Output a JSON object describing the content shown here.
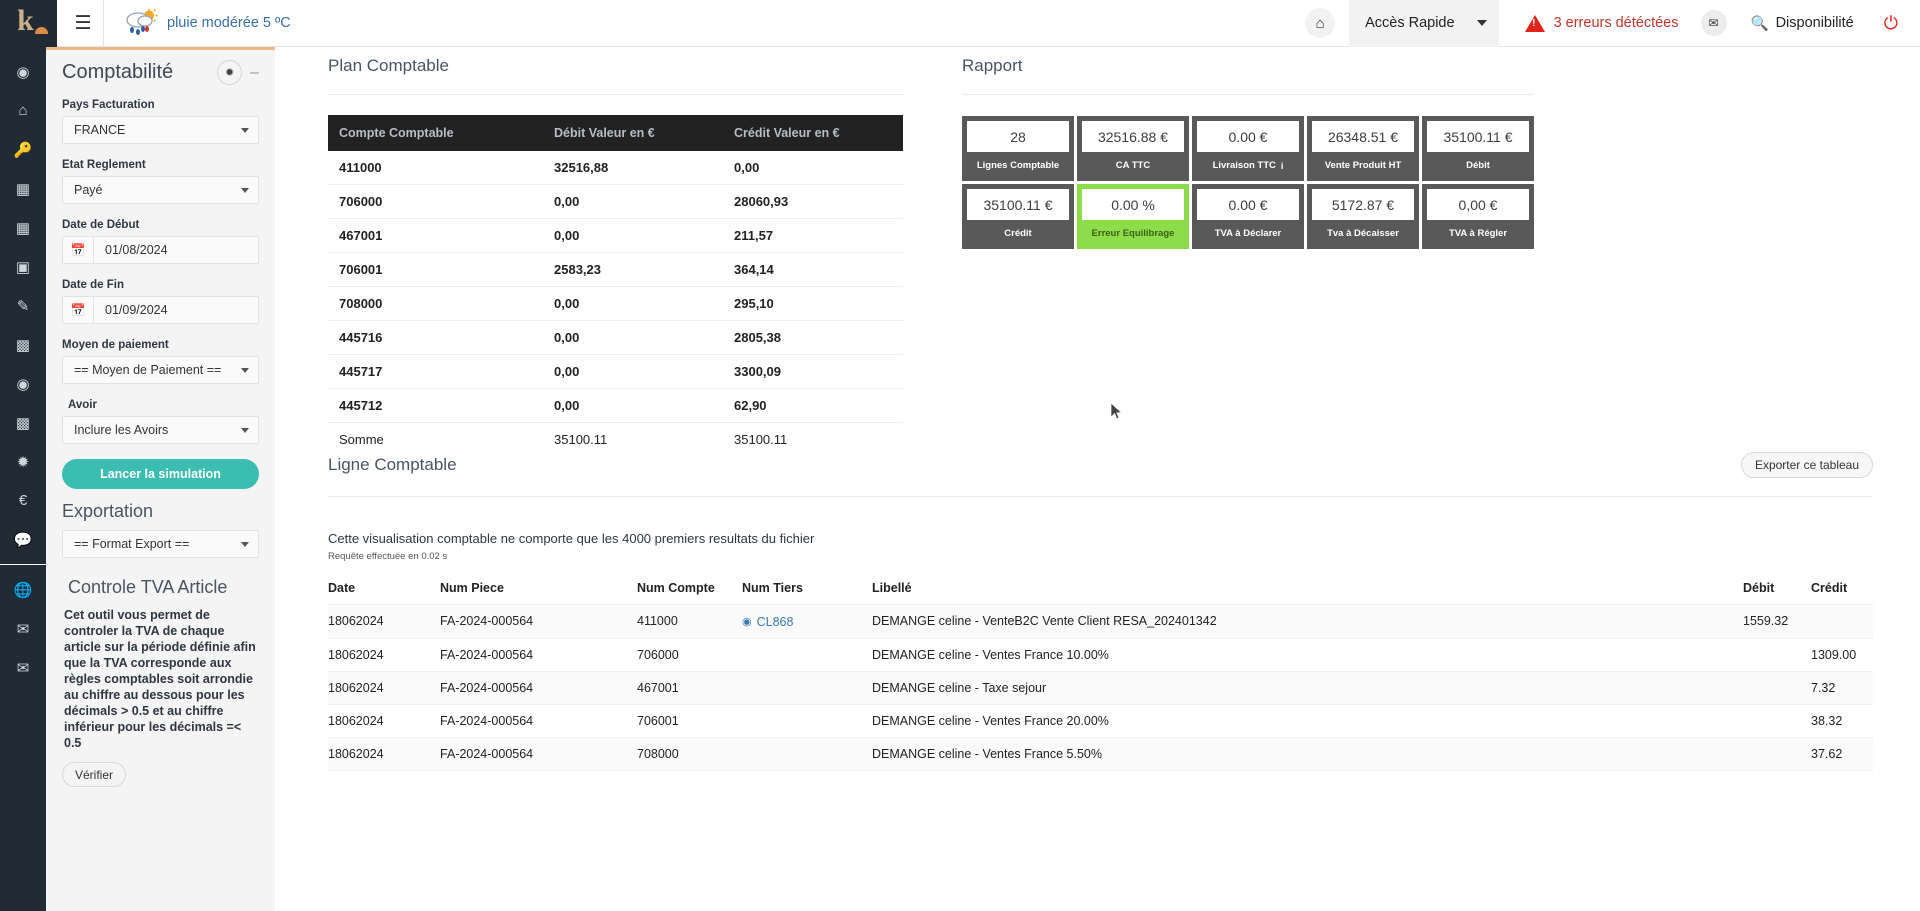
{
  "topbar": {
    "logo_letter": "k",
    "menu_icon": "hamburger-icon",
    "weather": "pluie modérée 5 ºC",
    "home_icon": "home-icon",
    "quick_access": "Accès Rapide",
    "errors": "3 erreurs détéctées",
    "mail_icon": "envelope-icon",
    "availability": "Disponibilité",
    "power_icon": "power-icon"
  },
  "rail": {
    "items": [
      {
        "name": "dashboard-icon",
        "glyph": "◐"
      },
      {
        "name": "home-icon",
        "glyph": "⌂"
      },
      {
        "name": "key-icon",
        "glyph": "🔑"
      },
      {
        "name": "card-icon",
        "glyph": "▤"
      },
      {
        "name": "calculator-icon",
        "glyph": "▦"
      },
      {
        "name": "contact-icon",
        "glyph": "▣"
      },
      {
        "name": "pencil-icon",
        "glyph": "✎"
      },
      {
        "name": "map-icon",
        "glyph": "▥"
      },
      {
        "name": "user-icon",
        "glyph": "◉"
      },
      {
        "name": "gift-icon",
        "glyph": "▩"
      },
      {
        "name": "settings-icon",
        "glyph": "✿"
      },
      {
        "name": "euro-icon",
        "glyph": "€"
      },
      {
        "name": "chat-icon",
        "glyph": "💬"
      },
      {
        "name": "globe-icon",
        "glyph": "⊕"
      },
      {
        "name": "mail-icon",
        "glyph": "✉"
      },
      {
        "name": "mail2-icon",
        "glyph": "✉"
      }
    ]
  },
  "panel": {
    "title": "Comptabilité",
    "gear_icon": "gear-icon",
    "minimize_icon": "minus-icon",
    "fields": {
      "pays_label": "Pays Facturation",
      "pays_value": "FRANCE",
      "etat_label": "Etat Reglement",
      "etat_value": "Payé",
      "debut_label": "Date de Début",
      "debut_value": "01/08/2024",
      "fin_label": "Date de Fin",
      "fin_value": "01/09/2024",
      "moyen_label": "Moyen de paiement",
      "moyen_value": "== Moyen de Paiement ==",
      "avoir_label": "Avoir",
      "avoir_value": "Inclure les Avoirs"
    },
    "simulate_button": "Lancer la simulation",
    "export_title": "Exportation",
    "export_value": "== Format Export ==",
    "tva_title": "Controle TVA Article",
    "tva_text": "Cet outil vous permet de controler la TVA de chaque article sur la période définie afin que la TVA corresponde aux règles comptables soit arrondie au chiffre au dessous pour les décimals > 0.5 et au chiffre inférieur pour les décimals =< 0.5",
    "verify_button": "Vérifier"
  },
  "plan_comptable": {
    "title": "Plan Comptable",
    "headers": [
      "Compte Comptable",
      "Débit Valeur en €",
      "Crédit Valeur en €"
    ],
    "rows": [
      [
        "411000",
        "32516,88",
        "0,00"
      ],
      [
        "706000",
        "0,00",
        "28060,93"
      ],
      [
        "467001",
        "0,00",
        "211,57"
      ],
      [
        "706001",
        "2583,23",
        "364,14"
      ],
      [
        "708000",
        "0,00",
        "295,10"
      ],
      [
        "445716",
        "0,00",
        "2805,38"
      ],
      [
        "445717",
        "0,00",
        "3300,09"
      ],
      [
        "445712",
        "0,00",
        "62,90"
      ]
    ],
    "sum_row": [
      "Somme",
      "35100.11",
      "35100.11"
    ]
  },
  "rapport": {
    "title": "Rapport",
    "cards": [
      {
        "value": "28",
        "label": "Lignes Comptable",
        "green": false,
        "info": false
      },
      {
        "value": "32516.88 €",
        "label": "CA TTC",
        "green": false,
        "info": false
      },
      {
        "value": "0.00 €",
        "label": "Livraison TTC",
        "green": false,
        "info": true
      },
      {
        "value": "26348.51 €",
        "label": "Vente Produit HT",
        "green": false,
        "info": false
      },
      {
        "value": "35100.11 €",
        "label": "Débit",
        "green": false,
        "info": false
      },
      {
        "value": "35100.11 €",
        "label": "Crédit",
        "green": false,
        "info": false
      },
      {
        "value": "0.00 %",
        "label": "Erreur Equilibrage",
        "green": true,
        "info": false
      },
      {
        "value": "0.00 €",
        "label": "TVA à Déclarer",
        "green": false,
        "info": false
      },
      {
        "value": "5172.87 €",
        "label": "Tva à Décaisser",
        "green": false,
        "info": false
      },
      {
        "value": "0,00 €",
        "label": "TVA à Régler",
        "green": false,
        "info": false
      }
    ]
  },
  "ligne_comptable": {
    "title": "Ligne Comptable",
    "export_button": "Exporter ce tableau",
    "note": "Cette visualisation comptable ne comporte que les 4000 premiers resultats du fichier",
    "note_small": "Requête effectuée en 0.02 s",
    "headers": [
      "Date",
      "Num Piece",
      "Num Compte",
      "Num Tiers",
      "Libellé",
      "Débit",
      "Crédit"
    ],
    "rows": [
      {
        "date": "18062024",
        "piece": "FA-2024-000564",
        "compte": "411000",
        "tiers": "CL868",
        "tiers_icon": "eye-icon",
        "libelle": "DEMANGE celine - VenteB2C Vente Client RESA_202401342",
        "debit": "1559.32",
        "credit": ""
      },
      {
        "date": "18062024",
        "piece": "FA-2024-000564",
        "compte": "706000",
        "tiers": "",
        "tiers_icon": "",
        "libelle": "DEMANGE celine - Ventes France 10.00%",
        "debit": "",
        "credit": "1309.00"
      },
      {
        "date": "18062024",
        "piece": "FA-2024-000564",
        "compte": "467001",
        "tiers": "",
        "tiers_icon": "",
        "libelle": "DEMANGE celine - Taxe sejour",
        "debit": "",
        "credit": "7.32"
      },
      {
        "date": "18062024",
        "piece": "FA-2024-000564",
        "compte": "706001",
        "tiers": "",
        "tiers_icon": "",
        "libelle": "DEMANGE celine - Ventes France 20.00%",
        "debit": "",
        "credit": "38.32"
      },
      {
        "date": "18062024",
        "piece": "FA-2024-000564",
        "compte": "708000",
        "tiers": "",
        "tiers_icon": "",
        "libelle": "DEMANGE celine - Ventes France 5.50%",
        "debit": "",
        "credit": "37.62"
      }
    ]
  },
  "colors": {
    "accent_teal": "#3bbdb1",
    "header_dark": "#222222",
    "rail_dark": "#212b36",
    "green": "#8ddd4a",
    "error_red": "#c0392b",
    "link_blue": "#3b78b5",
    "panel_top": "#eeb887"
  }
}
